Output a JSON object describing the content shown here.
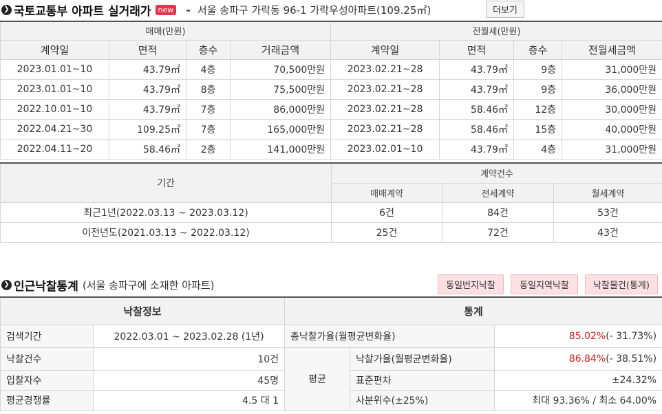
{
  "header": {
    "title": "국토교통부 아파트 실거래가",
    "badge": "new",
    "dash": "-",
    "subtitle": "서울 송파구 가락동 96-1 가락우성아파트(109.25㎡)",
    "more_button": "더보기",
    "bullet_icon": "❯"
  },
  "trades": {
    "sale_group": "매매(만원)",
    "rent_group": "전월세(만원)",
    "sale_columns": [
      "계약일",
      "면적",
      "층수",
      "거래금액"
    ],
    "rent_columns": [
      "계약일",
      "면적",
      "층수",
      "전월세금액"
    ],
    "rows": [
      {
        "s_date": "2023.01.01~10",
        "s_area": "43.79㎡",
        "s_floor": "4층",
        "s_price": "70,500만원",
        "r_date": "2023.02.21~28",
        "r_area": "43.79㎡",
        "r_floor": "9층",
        "r_price": "31,000만원"
      },
      {
        "s_date": "2023.01.01~10",
        "s_area": "43.79㎡",
        "s_floor": "8층",
        "s_price": "75,500만원",
        "r_date": "2023.02.21~28",
        "r_area": "43.79㎡",
        "r_floor": "9층",
        "r_price": "36,000만원"
      },
      {
        "s_date": "2022.10.01~10",
        "s_area": "43.79㎡",
        "s_floor": "7층",
        "s_price": "86,000만원",
        "r_date": "2023.02.21~28",
        "r_area": "58.46㎡",
        "r_floor": "12층",
        "r_price": "30,000만원"
      },
      {
        "s_date": "2022.04.21~30",
        "s_area": "109.25㎡",
        "s_floor": "7층",
        "s_price": "165,000만원",
        "r_date": "2023.02.21~28",
        "r_area": "58.46㎡",
        "r_floor": "15층",
        "r_price": "40,000만원"
      },
      {
        "s_date": "2022.04.11~20",
        "s_area": "58.46㎡",
        "s_floor": "2층",
        "s_price": "141,000만원",
        "r_date": "2023.02.01~10",
        "r_area": "43.79㎡",
        "r_floor": "4층",
        "r_price": "31,000만원"
      }
    ]
  },
  "counts": {
    "period_header": "기간",
    "count_group": "계약건수",
    "columns": [
      "매매계약",
      "전세계약",
      "월세계약"
    ],
    "rows": [
      {
        "period": "최근1년(2022.03.13 ~ 2023.03.12)",
        "sale": "6건",
        "jeonse": "84건",
        "monthly": "53건"
      },
      {
        "period": "이전년도(2021.03.13 ~ 2022.03.12)",
        "sale": "25건",
        "jeonse": "72건",
        "monthly": "43건"
      }
    ]
  },
  "auction": {
    "title": "인근낙찰통계",
    "note": "(서울 송파구에 소재한 아파트)",
    "buttons": [
      "동일번지낙찰",
      "동일지역낙찰",
      "낙찰물건(통계)"
    ],
    "info_header": "낙찰정보",
    "stats_header": "통계",
    "search_period_label": "검색기간",
    "search_period_value": "2022.03.01 ~ 2023.02.28 (1년)",
    "total_rate_label": "총낙찰가율(월평균변화율)",
    "total_rate_value": "85.02%",
    "total_rate_change": "(- 31.73%)",
    "count_label": "낙찰건수",
    "count_value": "10건",
    "avg_label": "평균",
    "rate_label": "낙찰가율(월평균변화율)",
    "rate_value": "86.84%",
    "rate_change": "(- 38.51%)",
    "bidders_label": "입찰자수",
    "bidders_value": "45명",
    "stddev_label": "표준편차",
    "stddev_value": "±24.32%",
    "competition_label": "평균경쟁률",
    "competition_value": "4.5 대 1",
    "quartile_label": "사분위수(±25%)",
    "quartile_value": "최대 93.36% / 최소 64.00%"
  },
  "colors": {
    "accent_red": "#d02020",
    "badge_red": "#e8334a",
    "button_pink": "#fde1e2"
  }
}
